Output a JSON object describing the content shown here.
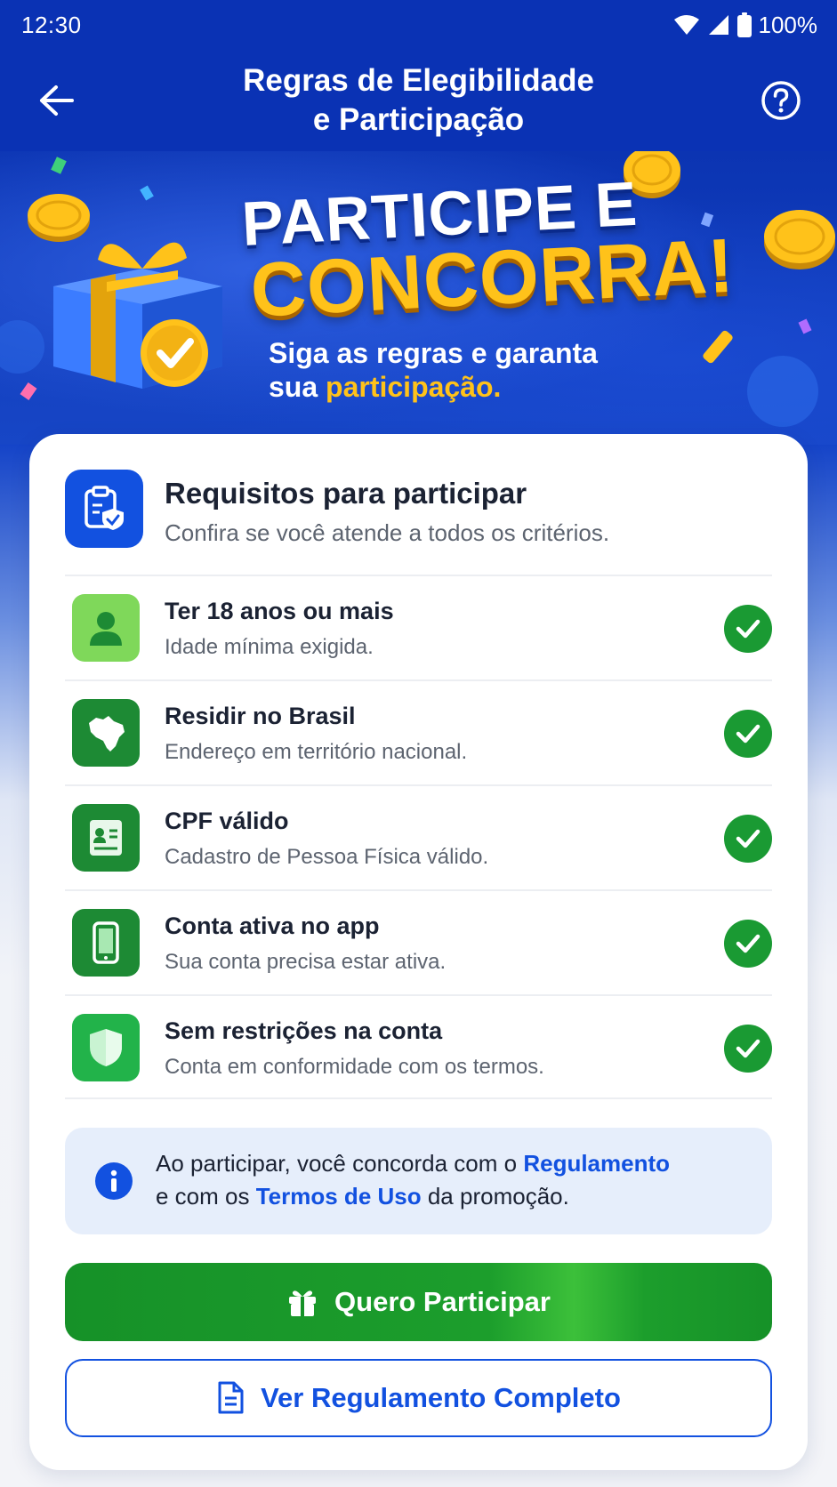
{
  "status_bar": {
    "time": "12:30",
    "battery": "100%"
  },
  "header": {
    "title_line1": "Regras de Elegibilidade",
    "title_line2": "e Participação"
  },
  "hero": {
    "title_line1": "PARTICIPE E",
    "title_line2": "CONCORRA!",
    "subtitle_line1": "Siga as regras e garanta",
    "subtitle_line2_prefix": "sua ",
    "subtitle_line2_highlight": "participação."
  },
  "requirements": {
    "title": "Requisitos para participar",
    "subtitle": "Confira se você atende a todos os critérios.",
    "items": [
      {
        "title": "Ter 18 anos ou mais",
        "desc": "Idade mínima exigida.",
        "icon": "user-icon",
        "color": "#7fd85a"
      },
      {
        "title": "Residir no Brasil",
        "desc": "Endereço em território nacional.",
        "icon": "brazil-map-icon",
        "color": "#1d8a34"
      },
      {
        "title": "CPF válido",
        "desc": "Cadastro de Pessoa Física válido.",
        "icon": "id-card-icon",
        "color": "#1d8a34"
      },
      {
        "title": "Conta ativa no app",
        "desc": "Sua conta precisa estar ativa.",
        "icon": "phone-icon",
        "color": "#1d8a34"
      },
      {
        "title": "Sem restrições na conta",
        "desc": "Conta em conformidade com os termos.",
        "icon": "shield-icon",
        "color": "#22b34a"
      }
    ]
  },
  "notice": {
    "part1": "Ao participar, você concorda com o ",
    "link1": "Regulamento",
    "part2": "e com os ",
    "link2": "Termos de Uso",
    "part3": " da promoção."
  },
  "buttons": {
    "primary": "Quero Participar",
    "secondary": "Ver Regulamento Completo"
  },
  "colors": {
    "brand_blue": "#0a32b4",
    "accent_blue": "#1251e0",
    "success_green": "#1a9a33",
    "gold": "#ffc21a"
  }
}
